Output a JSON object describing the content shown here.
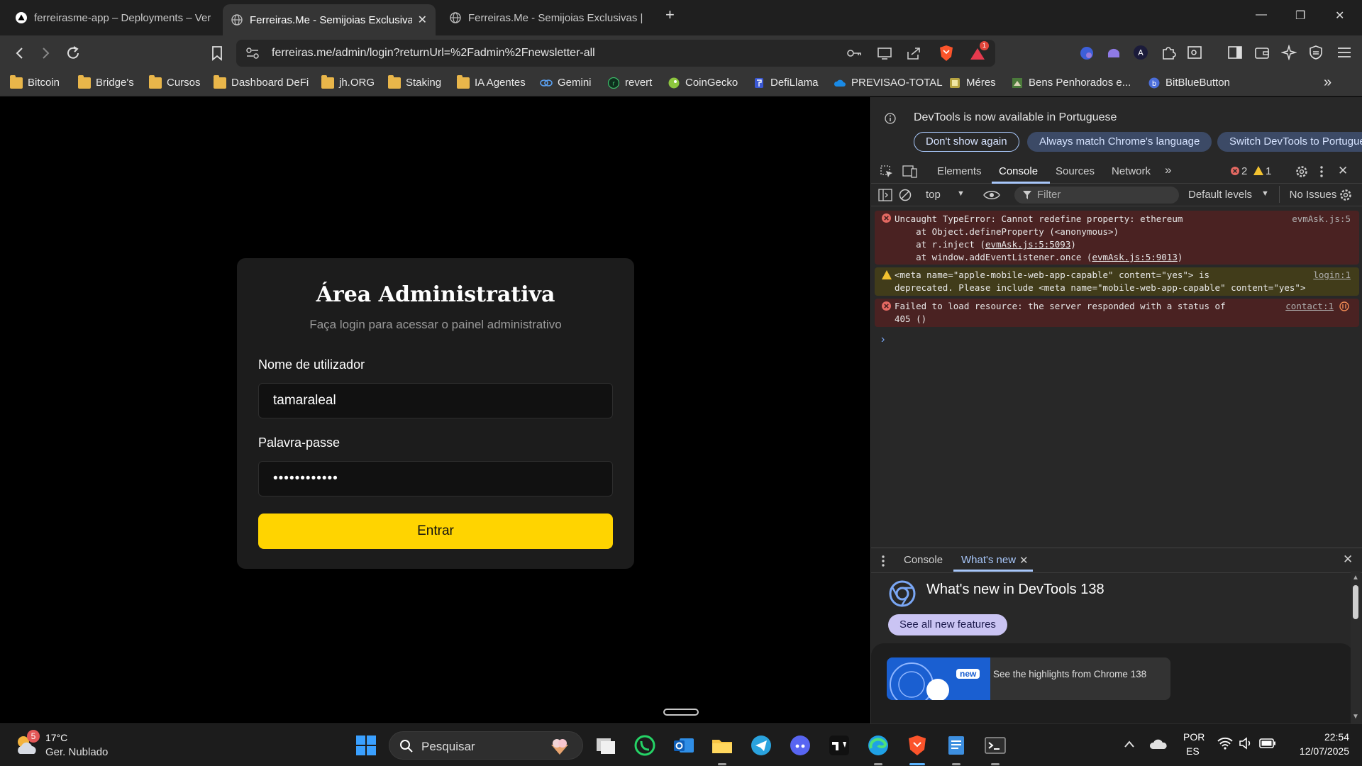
{
  "browser": {
    "tabs": [
      {
        "title": "ferreirasme-app – Deployments – Vercel"
      },
      {
        "title": "Ferreiras.Me - Semijoias Exclusivas"
      },
      {
        "title": "Ferreiras.Me - Semijoias Exclusivas | Joias"
      }
    ],
    "url": "ferreiras.me/admin/login?returnUrl=%2Fadmin%2Fnewsletter-all",
    "shields_badge": "1",
    "bookmarks": [
      {
        "label": "Bitcoin",
        "icon": "folder-icon"
      },
      {
        "label": "Bridge's",
        "icon": "folder-icon"
      },
      {
        "label": "Cursos",
        "icon": "folder-icon"
      },
      {
        "label": "Dashboard DeFi",
        "icon": "folder-icon"
      },
      {
        "label": "jh.ORG",
        "icon": "folder-icon"
      },
      {
        "label": "Staking",
        "icon": "folder-icon"
      },
      {
        "label": "IA Agentes",
        "icon": "folder-icon"
      },
      {
        "label": "Gemini",
        "icon": "gemini-icon"
      },
      {
        "label": "revert",
        "icon": "revert-icon"
      },
      {
        "label": "CoinGecko",
        "icon": "coingecko-icon"
      },
      {
        "label": "DefiLlama",
        "icon": "defillama-icon"
      },
      {
        "label": "PREVISAO-TOTAL",
        "icon": "cloud-icon"
      },
      {
        "label": "Méres",
        "icon": "meres-icon"
      },
      {
        "label": "Bens Penhorados e...",
        "icon": "bens-icon"
      },
      {
        "label": "BitBlueButton",
        "icon": "bitblue-icon"
      }
    ]
  },
  "login": {
    "title": "Área Administrativa",
    "subtitle": "Faça login para acessar o painel administrativo",
    "username_label": "Nome de utilizador",
    "username_value": "tamaraleal",
    "password_label": "Palavra-passe",
    "password_value": "••••••••••••",
    "submit_label": "Entrar"
  },
  "devtools": {
    "info_text": "DevTools is now available in Portuguese",
    "info_buttons": [
      "Don't show again",
      "Always match Chrome's language",
      "Switch DevTools to Portuguese"
    ],
    "tabs": [
      "Elements",
      "Console",
      "Sources",
      "Network"
    ],
    "error_count": "2",
    "warning_count": "1",
    "context": "top",
    "filter_placeholder": "Filter",
    "levels": "Default levels",
    "issues": "No Issues",
    "messages": [
      {
        "type": "error",
        "lines": [
          "Uncaught TypeError: Cannot redefine property: ethereum",
          "    at Object.defineProperty (<anonymous>)",
          "    at r.inject (",
          "    at window.addEventListener.once ("
        ],
        "links": [
          "evmAsk.js:5:5093",
          "evmAsk.js:5:9013"
        ],
        "source": "evmAsk.js:5"
      },
      {
        "type": "warning",
        "lines": [
          "<meta name=\"apple-mobile-web-app-capable\" content=\"yes\"> is",
          "deprecated. Please include <meta name=\"mobile-web-app-capable\" content=\"yes\">"
        ],
        "source": "login:1"
      },
      {
        "type": "error",
        "lines": [
          "Failed to load resource: the server responded with a status of",
          "405 ()"
        ],
        "source": "contact:1"
      }
    ],
    "prompt": "›",
    "drawer": {
      "tabs": [
        "Console",
        "What's new"
      ],
      "title": "What's new in DevTools 138",
      "button": "See all new features",
      "badge": "new",
      "highlight": "See the highlights from Chrome 138"
    }
  },
  "taskbar": {
    "weather_temp": "17°C",
    "weather_desc": "Ger. Nublado",
    "weather_badge": "5",
    "search": "Pesquisar",
    "lang_top": "POR",
    "lang_bottom": "ES",
    "time": "22:54",
    "date": "12/07/2025"
  }
}
